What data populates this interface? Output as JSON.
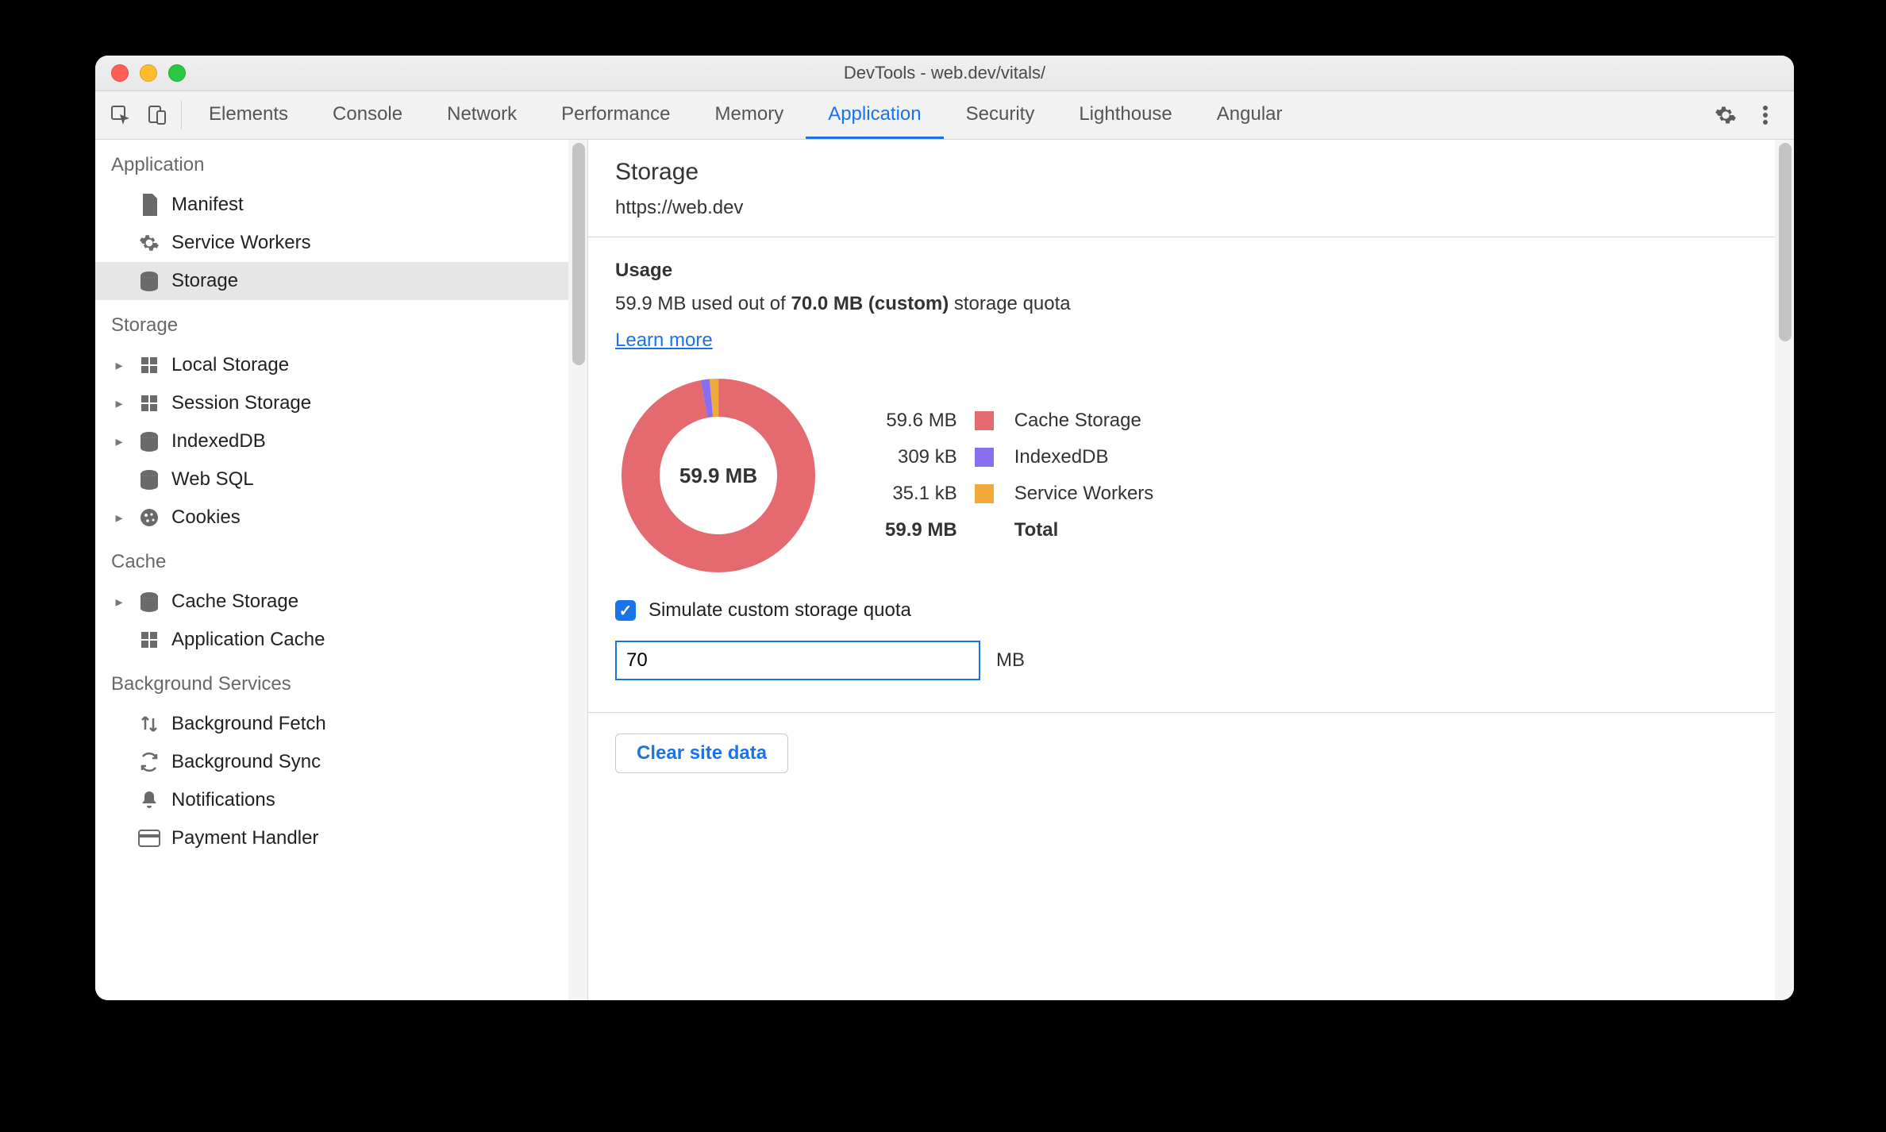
{
  "window": {
    "title": "DevTools - web.dev/vitals/"
  },
  "tabs": [
    "Elements",
    "Console",
    "Network",
    "Performance",
    "Memory",
    "Application",
    "Security",
    "Lighthouse",
    "Angular"
  ],
  "active_tab_index": 5,
  "sidebar": {
    "groups": [
      {
        "title": "Application",
        "items": [
          {
            "label": "Manifest",
            "icon": "manifest-icon",
            "expandable": false
          },
          {
            "label": "Service Workers",
            "icon": "gear-icon",
            "expandable": false
          },
          {
            "label": "Storage",
            "icon": "database-icon",
            "expandable": false,
            "selected": true
          }
        ]
      },
      {
        "title": "Storage",
        "items": [
          {
            "label": "Local Storage",
            "icon": "grid-icon",
            "expandable": true
          },
          {
            "label": "Session Storage",
            "icon": "grid-icon",
            "expandable": true
          },
          {
            "label": "IndexedDB",
            "icon": "database-icon",
            "expandable": true
          },
          {
            "label": "Web SQL",
            "icon": "database-icon",
            "expandable": false
          },
          {
            "label": "Cookies",
            "icon": "cookie-icon",
            "expandable": true
          }
        ]
      },
      {
        "title": "Cache",
        "items": [
          {
            "label": "Cache Storage",
            "icon": "database-icon",
            "expandable": true
          },
          {
            "label": "Application Cache",
            "icon": "grid-icon",
            "expandable": false
          }
        ]
      },
      {
        "title": "Background Services",
        "items": [
          {
            "label": "Background Fetch",
            "icon": "arrows-updown-icon",
            "expandable": false
          },
          {
            "label": "Background Sync",
            "icon": "sync-icon",
            "expandable": false
          },
          {
            "label": "Notifications",
            "icon": "bell-icon",
            "expandable": false
          },
          {
            "label": "Payment Handler",
            "icon": "card-icon",
            "expandable": false
          }
        ]
      }
    ]
  },
  "main": {
    "title": "Storage",
    "origin": "https://web.dev",
    "usage_heading": "Usage",
    "usage_used": "59.9 MB",
    "usage_join": " used out of ",
    "usage_quota": "70.0 MB (custom)",
    "usage_suffix": " storage quota",
    "learn_more": "Learn more",
    "donut_center": "59.9 MB",
    "legend": [
      {
        "value": "59.6 MB",
        "label": "Cache Storage",
        "color": "#e46a6f"
      },
      {
        "value": "309 kB",
        "label": "IndexedDB",
        "color": "#8a6ef0"
      },
      {
        "value": "35.1 kB",
        "label": "Service Workers",
        "color": "#f0a93c"
      }
    ],
    "total_value": "59.9 MB",
    "total_label": "Total",
    "simulate_label": "Simulate custom storage quota",
    "quota_value": "70",
    "quota_unit": "MB",
    "clear_button": "Clear site data"
  },
  "chart_data": {
    "type": "pie",
    "title": "Storage usage",
    "total": "59.9 MB",
    "series": [
      {
        "name": "Cache Storage",
        "value_label": "59.6 MB",
        "value_bytes": 59600000,
        "color": "#e46a6f"
      },
      {
        "name": "IndexedDB",
        "value_label": "309 kB",
        "value_bytes": 309000,
        "color": "#8a6ef0"
      },
      {
        "name": "Service Workers",
        "value_label": "35.1 kB",
        "value_bytes": 35100,
        "color": "#f0a93c"
      }
    ]
  }
}
